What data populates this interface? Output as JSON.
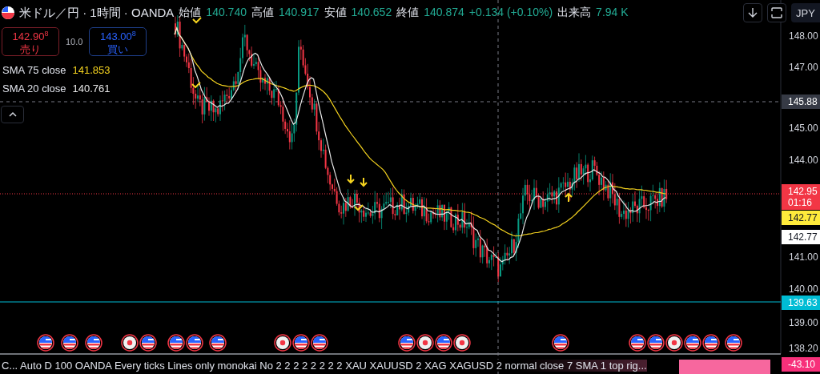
{
  "header": {
    "title": "米ドル／円 · 1時間 · OANDA",
    "ohlc": [
      {
        "label": "始値",
        "value": "140.740"
      },
      {
        "label": "高値",
        "value": "140.917"
      },
      {
        "label": "安値",
        "value": "140.652"
      },
      {
        "label": "終値",
        "value": "140.874"
      }
    ],
    "change": "+0.134 (+0.10%)",
    "volume": {
      "label": "出来高",
      "value": "7.94 K"
    },
    "currency": "JPY"
  },
  "trade": {
    "sell": {
      "price": "142.90$^{8}$",
      "label": "売り"
    },
    "spread": "10.0",
    "buy": {
      "price": "143.00$^{8}$",
      "label": "買い"
    }
  },
  "legend": [
    {
      "name": "SMA 75 close",
      "value": "141.853",
      "color": "#f5d31f"
    },
    {
      "name": "SMA 20 close",
      "value": "140.761",
      "color": "#e8e8e8"
    }
  ],
  "price_axis": {
    "ticks": [
      "148.00",
      "147.00",
      "145.00",
      "144.00",
      "141.00",
      "140.00",
      "139.00",
      "138.20"
    ],
    "markers": [
      {
        "label": "145.88",
        "color": "#363a45"
      },
      {
        "label": "142.95",
        "sublabel": "01:16",
        "color": "#f23645"
      },
      {
        "label": "142.77",
        "color": "#ffeb3b"
      },
      {
        "label": "142.77",
        "color": "#ffffff"
      },
      {
        "label": "139.63",
        "color": "#00bcd4"
      },
      {
        "label": "-43.10",
        "color": "#f7307a"
      }
    ]
  },
  "events": [
    {
      "kind": "us"
    },
    {
      "kind": "us"
    },
    {
      "kind": "us"
    },
    {
      "kind": "jp"
    },
    {
      "kind": "us"
    },
    {
      "kind": "us"
    },
    {
      "kind": "us"
    },
    {
      "kind": "us"
    },
    {
      "kind": "jp"
    },
    {
      "kind": "us"
    },
    {
      "kind": "us"
    },
    {
      "kind": "us"
    },
    {
      "kind": "jp"
    },
    {
      "kind": "us"
    },
    {
      "kind": "jp"
    },
    {
      "kind": "us"
    },
    {
      "kind": "us"
    },
    {
      "kind": "us"
    },
    {
      "kind": "jp"
    },
    {
      "kind": "us"
    },
    {
      "kind": "us"
    },
    {
      "kind": "us"
    }
  ],
  "status_bar": {
    "text": "C... Auto D 100 OANDA Every ticks Lines only monokai No 2 2 2 2 2 2 2 2 XAU XAUUSD 2 XAG XAGUSD 2 normal close 7 SMA 1 top rig..."
  }
}
